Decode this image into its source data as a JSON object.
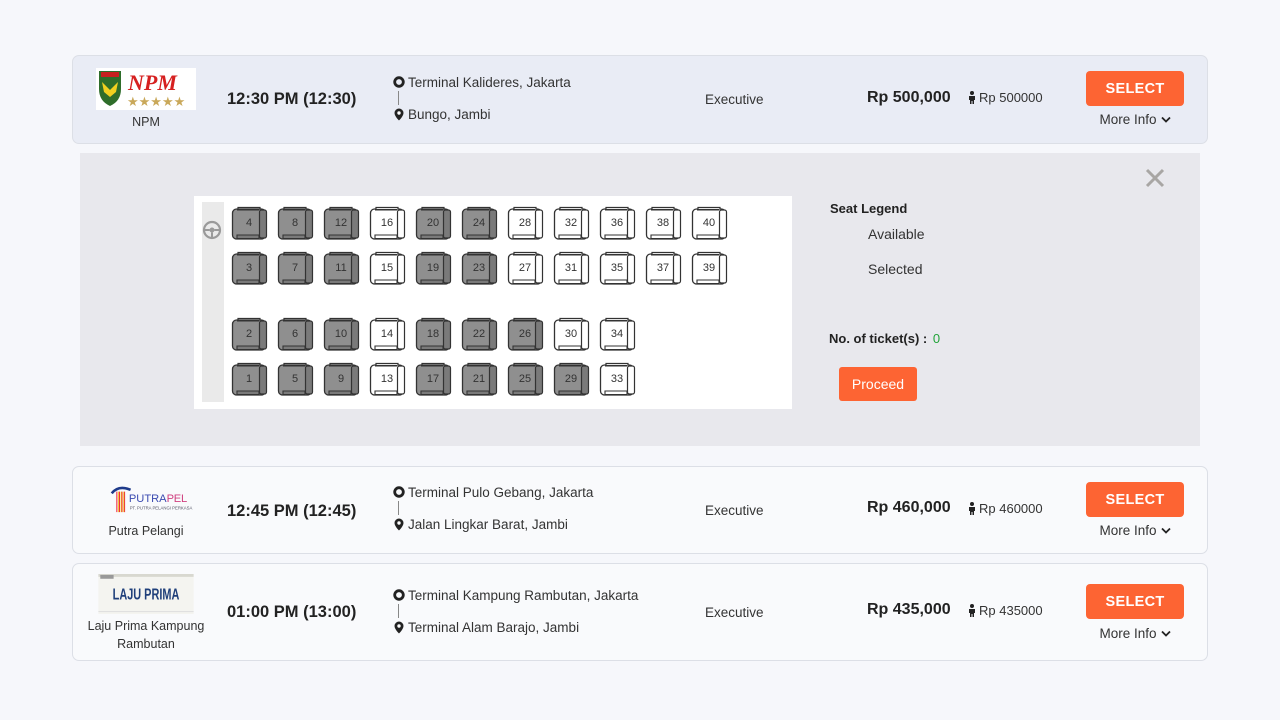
{
  "results": [
    {
      "operator": "NPM",
      "logo": "npm-logo",
      "departure": "12:30 PM (12:30)",
      "origin": "Terminal Kalideres, Jakarta",
      "destination": "Bungo, Jambi",
      "class": "Executive",
      "price": "Rp 500,000",
      "per_person": "Rp 500000",
      "select_label": "SELECT",
      "more_info_label": "More Info",
      "expanded": true
    },
    {
      "operator": "Putra Pelangi",
      "logo": "putra-pelangi-logo",
      "departure": "12:45 PM (12:45)",
      "origin": "Terminal Pulo Gebang, Jakarta",
      "destination": "Jalan Lingkar Barat, Jambi",
      "class": "Executive",
      "price": "Rp 460,000",
      "per_person": "Rp 460000",
      "select_label": "SELECT",
      "more_info_label": "More Info",
      "expanded": false
    },
    {
      "operator": "Laju Prima Kampung Rambutan",
      "logo": "laju-prima-logo",
      "departure": "01:00 PM (13:00)",
      "origin": "Terminal Kampung Rambutan, Jakarta",
      "destination": "Terminal Alam Barajo, Jambi",
      "class": "Executive",
      "price": "Rp 435,000",
      "per_person": "Rp 435000",
      "select_label": "SELECT",
      "more_info_label": "More Info",
      "expanded": false
    }
  ],
  "seat_map": {
    "rows": [
      [
        "4",
        "8",
        "12",
        "16",
        "20",
        "24",
        "28",
        "32",
        "36",
        "38",
        "40"
      ],
      [
        "3",
        "7",
        "11",
        "15",
        "19",
        "23",
        "27",
        "31",
        "35",
        "37",
        "39"
      ],
      [
        "2",
        "6",
        "10",
        "14",
        "18",
        "22",
        "26",
        "30",
        "34"
      ],
      [
        "1",
        "5",
        "9",
        "13",
        "17",
        "21",
        "25",
        "29",
        "33"
      ]
    ],
    "booked": [
      "1",
      "2",
      "3",
      "4",
      "5",
      "6",
      "7",
      "8",
      "9",
      "10",
      "11",
      "12",
      "17",
      "18",
      "19",
      "20",
      "21",
      "22",
      "23",
      "24",
      "25",
      "26",
      "29"
    ],
    "legend_title": "Seat Legend",
    "legend": {
      "available": "Available",
      "selected": "Selected"
    },
    "tickets_label": "No. of ticket(s) :",
    "tickets_count": "0",
    "proceed_label": "Proceed"
  },
  "colors": {
    "accent": "#fd6433",
    "booked_seat": "#8f8f8f",
    "available_seat": "#ffffff",
    "ticket_count": "#22a33a"
  }
}
